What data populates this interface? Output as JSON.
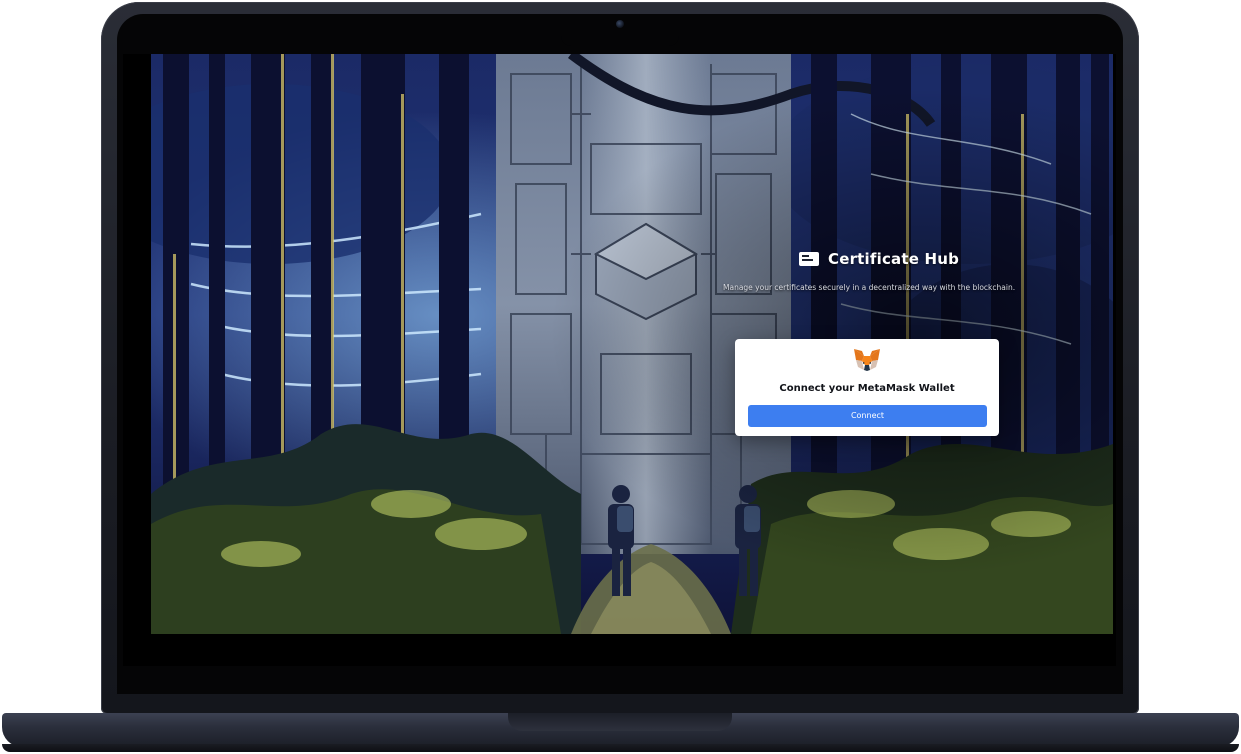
{
  "app": {
    "title": "Certificate Hub",
    "subtitle": "Manage your certificates securely in a decentralized way with the blockchain.",
    "icon": "certificate-card-icon"
  },
  "wallet_card": {
    "icon": "metamask-fox-icon",
    "title": "Connect your MetaMask Wallet",
    "button_label": "Connect"
  },
  "colors": {
    "accent": "#3d7ef0",
    "card_background": "#ffffff",
    "forest_deep": "#141a4a",
    "foliage_glow": "#c8d86a"
  }
}
